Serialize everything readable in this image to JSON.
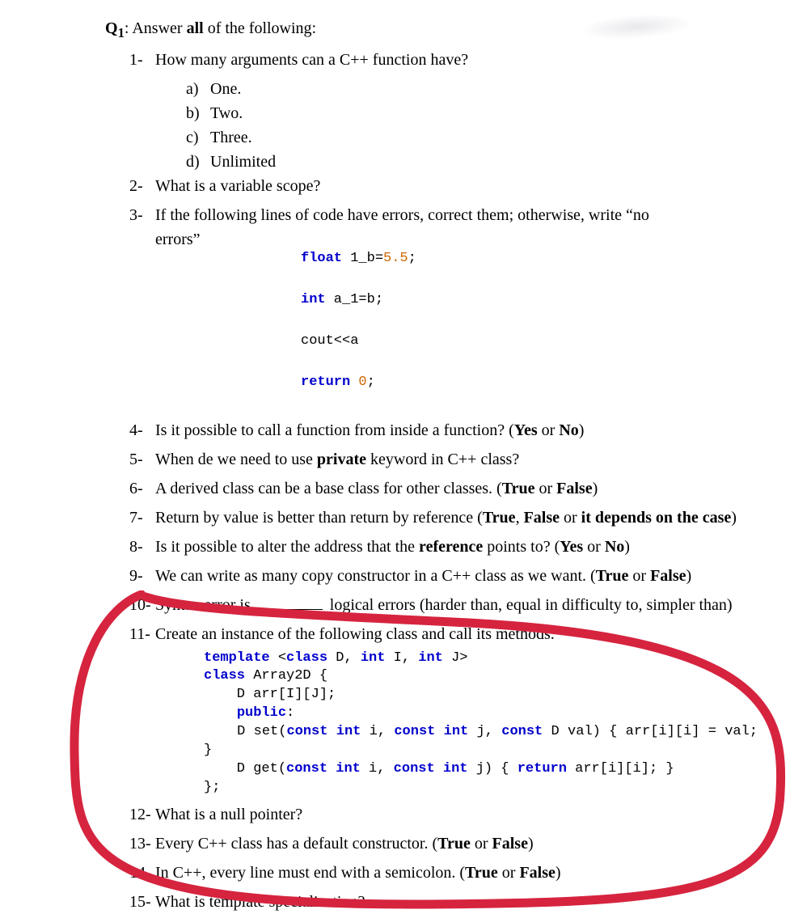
{
  "title_prefix": "Q",
  "title_sub": "1",
  "title_after": ": Answer ",
  "title_bold": "all",
  "title_rest": " of the following:",
  "q1": {
    "num": "1-",
    "text": "How many arguments can a C++ function have?",
    "opts": {
      "a_lbl": "a)",
      "a": "One.",
      "b_lbl": "b)",
      "b": "Two.",
      "c_lbl": "c)",
      "c": "Three.",
      "d_lbl": "d)",
      "d": "Unlimited"
    }
  },
  "q2": {
    "num": "2-",
    "text": "What is a variable scope?"
  },
  "q3": {
    "num": "3-",
    "lead": "If the following lines of code have errors, correct them; otherwise, write “no",
    "errors_word": "errors”",
    "code": {
      "l1a": "float",
      "l1b": " 1_b=",
      "l1c": "5.5",
      "l1d": ";",
      "l2a": "int",
      "l2b": " a_1=b;",
      "l3a": "cout<<a",
      "l4a": "return",
      "l4b": " ",
      "l4c": "0",
      "l4d": ";"
    }
  },
  "q4": {
    "num": "4-",
    "text": "Is it possible to call a function from inside a function? (",
    "yes": "Yes",
    "or": " or ",
    "no": "No",
    "end": ")"
  },
  "q5": {
    "num": "5-",
    "t1": "When de we need to use ",
    "kw": "private",
    "t2": " keyword in C++ class?"
  },
  "q6": {
    "num": "6-",
    "t1": "A derived class can be a base class for other classes. (",
    "true": "True",
    "or": " or ",
    "false": "False",
    "end": ")"
  },
  "q7": {
    "num": "7-",
    "t1": "Return by value is better than return by reference (",
    "true": "True",
    "c1": ", ",
    "false": "False",
    "or": " or ",
    "dep": "it depends on the case",
    "end": ")"
  },
  "q8": {
    "num": "8-",
    "t1": "Is it possible to alter the address that the ",
    "ref": "reference",
    "t2": " points to? (",
    "yes": "Yes",
    "or": " or ",
    "no": "No",
    "end": ")"
  },
  "q9": {
    "num": "9-",
    "t1": "We can write as many copy constructor in a C++ class as we want. (",
    "true": "True",
    "or": " or ",
    "false": "False",
    "end": ")"
  },
  "q10": {
    "num": "10-",
    "t1": "Syntax error is ",
    "t2": " logical errors (harder than, equal in difficulty to, simpler than)"
  },
  "q11": {
    "num": "11-",
    "text": "Create an instance of the following class and call its methods.",
    "code": {
      "l1": "template <class D, int I, int J>",
      "l2": "class Array2D {",
      "l3": "    D arr[I][J];",
      "l4": "    public:",
      "l5": "    D set(const int i, const int j, const D val) { arr[i][i] = val; }",
      "l6": "    D get(const int i, const int j) { return arr[i][i]; }",
      "l7": "};"
    }
  },
  "q12": {
    "num": "12-",
    "text": "What is a null pointer?"
  },
  "q13": {
    "num": "13-",
    "t1": "Every C++ class has a default constructor. (",
    "true": "True",
    "or": " or ",
    "false": "False",
    "end": ")"
  },
  "q14": {
    "num": "14-",
    "t1": "In C++, every line must end with a semicolon. (",
    "true": "True",
    "or": " or ",
    "false": "False",
    "end": ")"
  },
  "q15": {
    "num": "15-",
    "text": "What is template specialization?"
  }
}
